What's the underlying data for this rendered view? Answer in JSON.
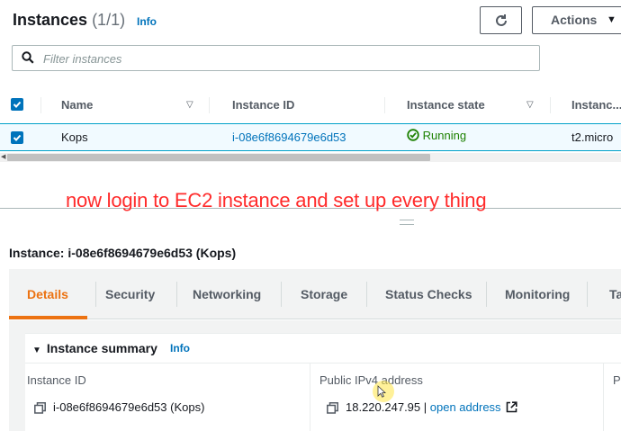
{
  "header": {
    "title": "Instances",
    "count": "(1/1)",
    "info": "Info",
    "actions_label": "Actions",
    "search_placeholder": "Filter instances"
  },
  "table": {
    "columns": [
      "Name",
      "Instance ID",
      "Instance state",
      "Instanc..."
    ],
    "rows": [
      {
        "name": "Kops",
        "instance_id": "i-08e6f8694679e6d53",
        "state": "Running",
        "type": "t2.micro"
      }
    ]
  },
  "overlay_text": "now login to EC2 instance and set up every thing",
  "panel": {
    "title": "Instance: i-08e6f8694679e6d53 (Kops)",
    "tabs": [
      "Details",
      "Security",
      "Networking",
      "Storage",
      "Status Checks",
      "Monitoring",
      "Ta"
    ],
    "active_tab": "Details",
    "summary_title": "Instance summary",
    "summary_info": "Info",
    "fields": [
      {
        "label": "Instance ID",
        "value": "i-08e6f8694679e6d53 (Kops)"
      },
      {
        "label": "Public IPv4 address",
        "value": "18.220.247.95",
        "link": "open address"
      },
      {
        "label": "P"
      }
    ]
  },
  "colors": {
    "link": "#0073bb",
    "accent": "#ec7211",
    "running": "#1d8102",
    "overlay": "#ff2b2b"
  }
}
